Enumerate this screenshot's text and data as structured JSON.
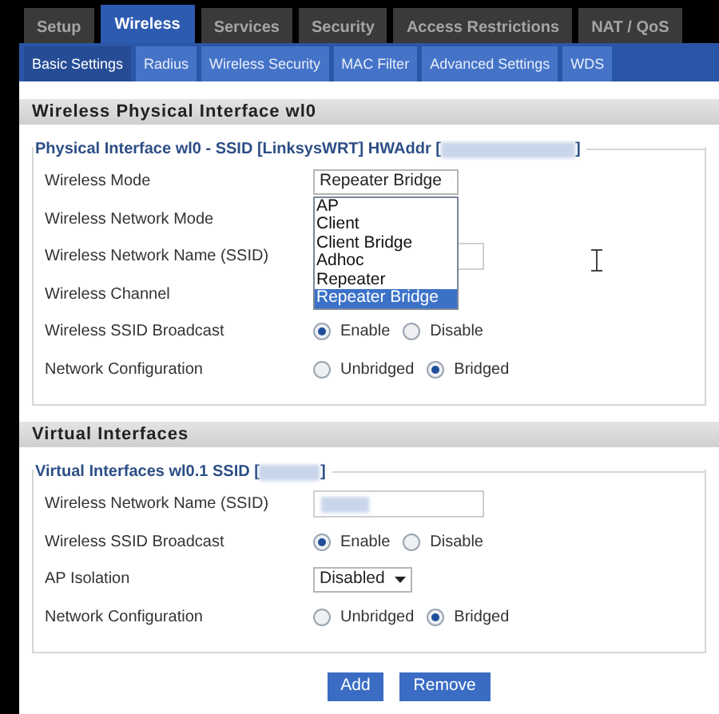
{
  "top_tabs": [
    {
      "label": "Setup",
      "selected": false
    },
    {
      "label": "Wireless",
      "selected": true
    },
    {
      "label": "Services",
      "selected": false
    },
    {
      "label": "Security",
      "selected": false
    },
    {
      "label": "Access Restrictions",
      "selected": false
    },
    {
      "label": "NAT / QoS",
      "selected": false
    }
  ],
  "sub_tabs": [
    {
      "label": "Basic Settings",
      "selected": true
    },
    {
      "label": "Radius",
      "selected": false
    },
    {
      "label": "Wireless Security",
      "selected": false
    },
    {
      "label": "MAC Filter",
      "selected": false
    },
    {
      "label": "Advanced Settings",
      "selected": false
    },
    {
      "label": "WDS",
      "selected": false
    }
  ],
  "sections": [
    {
      "title": "Wireless Physical Interface wl0",
      "legend_start": "Physical Interface wl0 - SSID [LinksysWRT] HWAddr [",
      "legend_end": "]",
      "rows": [
        {
          "kind": "dropdown_open",
          "label": "Wireless Mode",
          "value": "Repeater Bridge",
          "options": [
            {
              "label": "AP",
              "selected": false
            },
            {
              "label": "Client",
              "selected": false
            },
            {
              "label": "Client Bridge",
              "selected": false
            },
            {
              "label": "Adhoc",
              "selected": false
            },
            {
              "label": "Repeater",
              "selected": false
            },
            {
              "label": "Repeater Bridge",
              "selected": true
            }
          ]
        },
        {
          "kind": "covered",
          "label": "Wireless Network Mode"
        },
        {
          "kind": "text",
          "label": "Wireless Network Name (SSID)"
        },
        {
          "kind": "covered",
          "label": "Wireless Channel"
        },
        {
          "kind": "radio",
          "label": "Wireless SSID Broadcast",
          "options": [
            {
              "label": "Enable",
              "selected": true
            },
            {
              "label": "Disable",
              "selected": false
            }
          ]
        },
        {
          "kind": "radio",
          "label": "Network Configuration",
          "options": [
            {
              "label": "Unbridged",
              "selected": false
            },
            {
              "label": "Bridged",
              "selected": true
            }
          ]
        }
      ]
    },
    {
      "title": "Virtual Interfaces",
      "legend_start": "Virtual Interfaces wl0.1 SSID [",
      "legend_end": "]",
      "rows": [
        {
          "kind": "text",
          "label": "Wireless Network Name (SSID)",
          "blurred": true
        },
        {
          "kind": "radio",
          "label": "Wireless SSID Broadcast",
          "options": [
            {
              "label": "Enable",
              "selected": true
            },
            {
              "label": "Disable",
              "selected": false
            }
          ]
        },
        {
          "kind": "dropdown",
          "label": "AP Isolation",
          "value": "Disabled"
        },
        {
          "kind": "radio",
          "label": "Network Configuration",
          "options": [
            {
              "label": "Unbridged",
              "selected": false
            },
            {
              "label": "Bridged",
              "selected": true
            }
          ]
        }
      ]
    }
  ],
  "buttons": [
    "Add",
    "Remove"
  ]
}
